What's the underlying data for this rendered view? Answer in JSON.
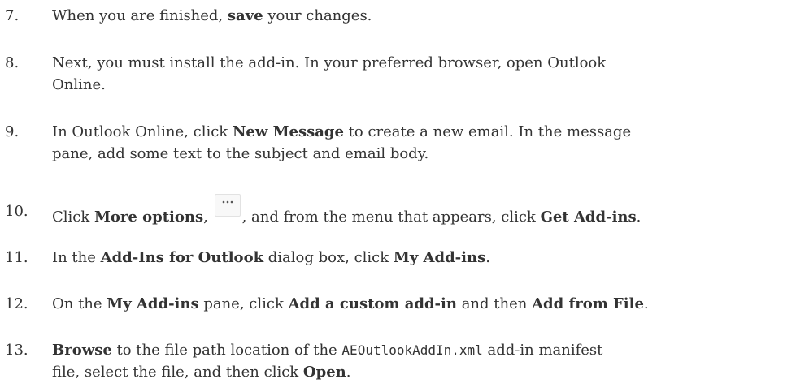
{
  "steps": [
    {
      "num": "7.",
      "lines": [
        [
          {
            "t": "When you are finished, "
          },
          {
            "t": "save",
            "b": true
          },
          {
            "t": " your changes."
          }
        ]
      ]
    },
    {
      "num": "8.",
      "lines": [
        [
          {
            "t": "Next, you must install the add-in. In your preferred browser, open Outlook"
          }
        ],
        [
          {
            "t": "Online."
          }
        ]
      ]
    },
    {
      "num": "9.",
      "lines": [
        [
          {
            "t": "In Outlook Online, click "
          },
          {
            "t": "New Message",
            "b": true
          },
          {
            "t": " to create a new email. In the message"
          }
        ],
        [
          {
            "t": "pane, add some text to the subject and email body."
          }
        ]
      ]
    },
    {
      "num": "10.",
      "lines": [
        [
          {
            "t": "Click "
          },
          {
            "t": "More options",
            "b": true
          },
          {
            "t": ", "
          },
          {
            "icon": "more-options-icon"
          },
          {
            "t": ", and from the menu that appears, click "
          },
          {
            "t": "Get Add-ins",
            "b": true
          },
          {
            "t": "."
          }
        ]
      ]
    },
    {
      "num": "11.",
      "lines": [
        [
          {
            "t": "In the "
          },
          {
            "t": "Add-Ins for Outlook",
            "b": true
          },
          {
            "t": " dialog box, click "
          },
          {
            "t": "My Add-ins",
            "b": true
          },
          {
            "t": "."
          }
        ]
      ]
    },
    {
      "num": "12.",
      "lines": [
        [
          {
            "t": "On the "
          },
          {
            "t": "My Add-ins",
            "b": true
          },
          {
            "t": " pane, click "
          },
          {
            "t": "Add a custom add-in",
            "b": true
          },
          {
            "t": " and then "
          },
          {
            "t": "Add from File",
            "b": true
          },
          {
            "t": "."
          }
        ]
      ]
    },
    {
      "num": "13.",
      "lines": [
        [
          {
            "t": "Browse",
            "b": true
          },
          {
            "t": " to the file path location of the "
          },
          {
            "t": "AEOutlookAddIn.xml",
            "code": true
          },
          {
            "t": " add-in manifest"
          }
        ],
        [
          {
            "t": "file, select the file, and then click "
          },
          {
            "t": "Open",
            "b": true
          },
          {
            "t": "."
          }
        ]
      ]
    }
  ]
}
